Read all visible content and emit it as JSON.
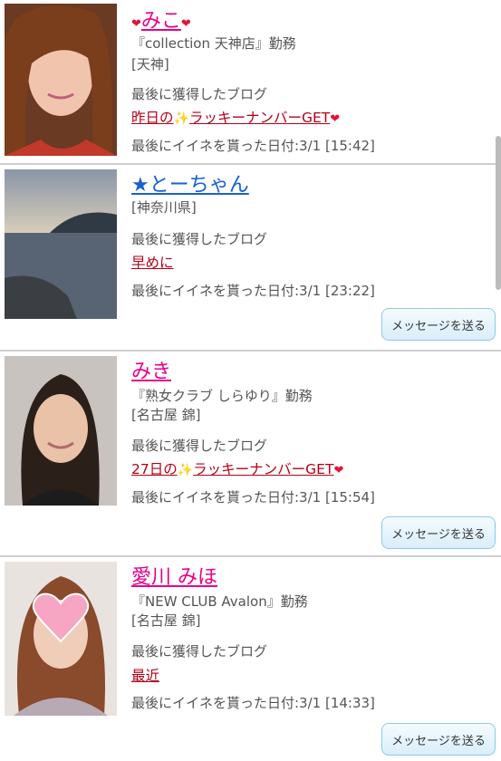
{
  "labels": {
    "last_blog": "最後に獲得したブログ",
    "message_button": "メッセージを送る"
  },
  "users": [
    {
      "name": "みこ",
      "workplace": "『collection 天神店』勤務",
      "area": "[天神]",
      "blog_title_pre": "昨日の",
      "blog_title_post": "ラッキーナンバーGET",
      "last_like": "最後にイイネを貰った日付:3/1 [15:42]"
    },
    {
      "name": "★とーちゃん",
      "area": "[神奈川県]",
      "blog_title": "早めに",
      "last_like": "最後にイイネを貰った日付:3/1 [23:22]"
    },
    {
      "name": "みき",
      "workplace": "『熟女クラブ しらゆり』勤務",
      "area": "[名古屋 錦]",
      "blog_title_pre": "27日の",
      "blog_title_post": "ラッキーナンバーGET",
      "last_like": "最後にイイネを貰った日付:3/1 [15:54]"
    },
    {
      "name": "愛川 みほ",
      "workplace": "『NEW CLUB Avalon』勤務",
      "area": "[名古屋 錦]",
      "blog_title": "最近",
      "last_like": "最後にイイネを貰った日付:3/1 [14:33]"
    }
  ],
  "colors": {
    "name_pink": "#e8008a",
    "name_blue": "#1a5fd0",
    "blog_link": "#b30018",
    "heart": "#e0143c",
    "button_border": "#8fc9e6"
  },
  "icons": [
    "heart-icon",
    "sparkle-icon"
  ]
}
